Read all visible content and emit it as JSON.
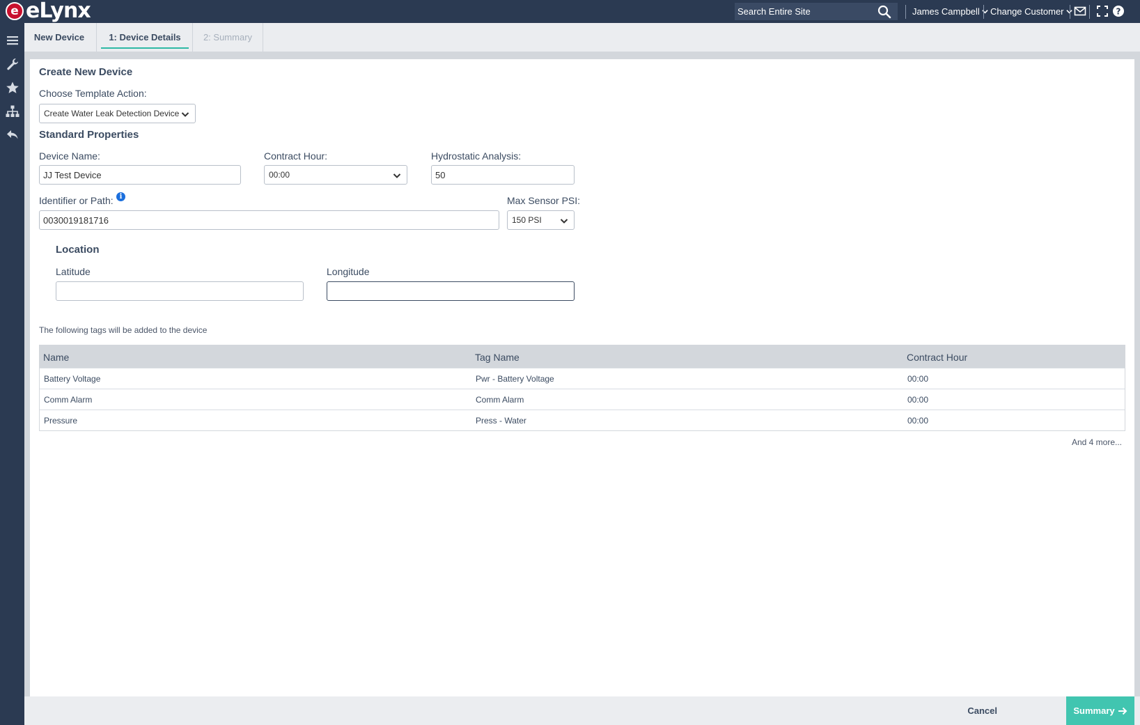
{
  "app": {
    "logo_letter": "e",
    "logo_text": "eLynx"
  },
  "header": {
    "search_placeholder": "Search Entire Site",
    "user_name": "James Campbell",
    "change_customer": "Change Customer"
  },
  "tabs": [
    {
      "label": "New Device"
    },
    {
      "label": "1: Device Details"
    },
    {
      "label": "2: Summary"
    }
  ],
  "form": {
    "title": "Create New Device",
    "template_action_label": "Choose Template Action:",
    "template_action_value": "Create Water Leak Detection Device",
    "standard_properties_title": "Standard Properties",
    "device_name_label": "Device Name:",
    "device_name_value": "JJ Test Device",
    "contract_hour_label": "Contract Hour:",
    "contract_hour_value": "00:00",
    "hydrostatic_label": "Hydrostatic Analysis:",
    "hydrostatic_value": "50",
    "identifier_label": "Identifier or Path:",
    "identifier_value": "0030019181716",
    "max_sensor_label": "Max Sensor PSI:",
    "max_sensor_value": "150 PSI",
    "location_title": "Location",
    "latitude_label": "Latitude",
    "latitude_value": "",
    "longitude_label": "Longitude",
    "longitude_value": ""
  },
  "tags": {
    "note": "The following tags will be added to the device",
    "columns": [
      "Name",
      "Tag Name",
      "Contract Hour"
    ],
    "rows": [
      [
        "Battery Voltage",
        "Pwr - Battery Voltage",
        "00:00"
      ],
      [
        "Comm Alarm",
        "Comm Alarm",
        "00:00"
      ],
      [
        "Pressure",
        "Press - Water",
        "00:00"
      ]
    ],
    "more": "And 4 more..."
  },
  "footer": {
    "cancel_label": "Cancel",
    "summary_label": "Summary"
  },
  "colors": {
    "navy": "#2b3a52",
    "accent_teal": "#41c5b0",
    "brand_red": "#c8102e"
  }
}
